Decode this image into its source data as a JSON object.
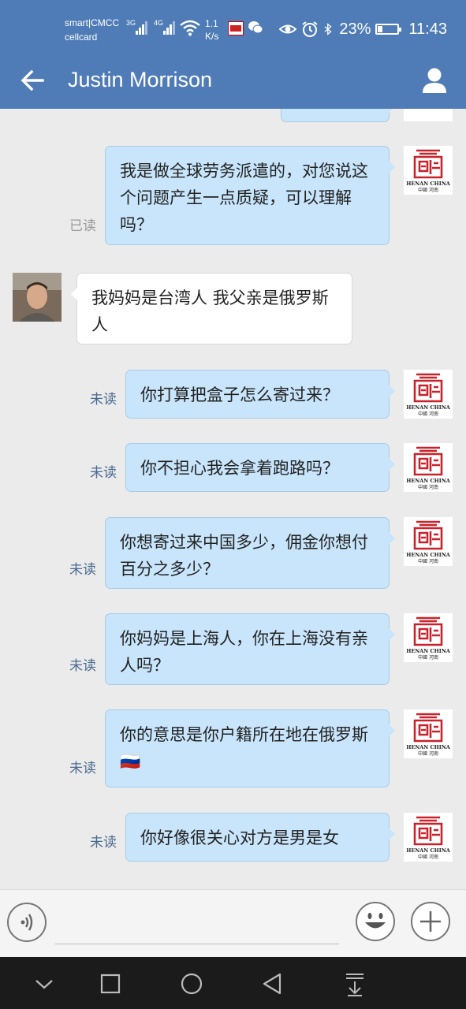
{
  "status_bar": {
    "carrier_line1": "smart|CMCC",
    "carrier_line2": "cellcard",
    "sig1_label": "3G",
    "sig2_label": "4G",
    "speed_value": "1.1",
    "speed_unit": "K/s",
    "battery": "23%",
    "battery_level": 0.23,
    "time": "11:43"
  },
  "header": {
    "title": "Justin Morrison"
  },
  "messages": [
    {
      "side": "out",
      "text": "我是做全球劳务派遣的，对您说这个问题产生一点质疑，可以理解吗？",
      "status": "已读"
    },
    {
      "side": "in",
      "text": "我妈妈是台湾人 我父亲是俄罗斯人"
    },
    {
      "side": "out",
      "text": "你打算把盒子怎么寄过来？",
      "status": "未读"
    },
    {
      "side": "out",
      "text": "你不担心我会拿着跑路吗？",
      "status": "未读"
    },
    {
      "side": "out",
      "text": "你想寄过来中国多少，佣金你想付百分之多少？",
      "status": "未读"
    },
    {
      "side": "out",
      "text": "你妈妈是上海人，你在上海没有亲人吗？",
      "status": "未读"
    },
    {
      "side": "out",
      "text": "你的意思是你户籍所在地在俄罗斯🇷🇺",
      "status": "未读"
    },
    {
      "side": "out",
      "text": "你好像很关心对方是男是女",
      "status": "未读"
    }
  ],
  "self_avatar": {
    "caption1": "HENAN CHINA",
    "caption2": "中國  河南"
  },
  "colors": {
    "header": "#4f7cb6",
    "bubble_out": "#c8e5fb",
    "bubble_in": "#ffffff",
    "status_unread": "#4a6a90",
    "status_read": "#9a9a9a",
    "navbar": "#1b1b1b"
  }
}
